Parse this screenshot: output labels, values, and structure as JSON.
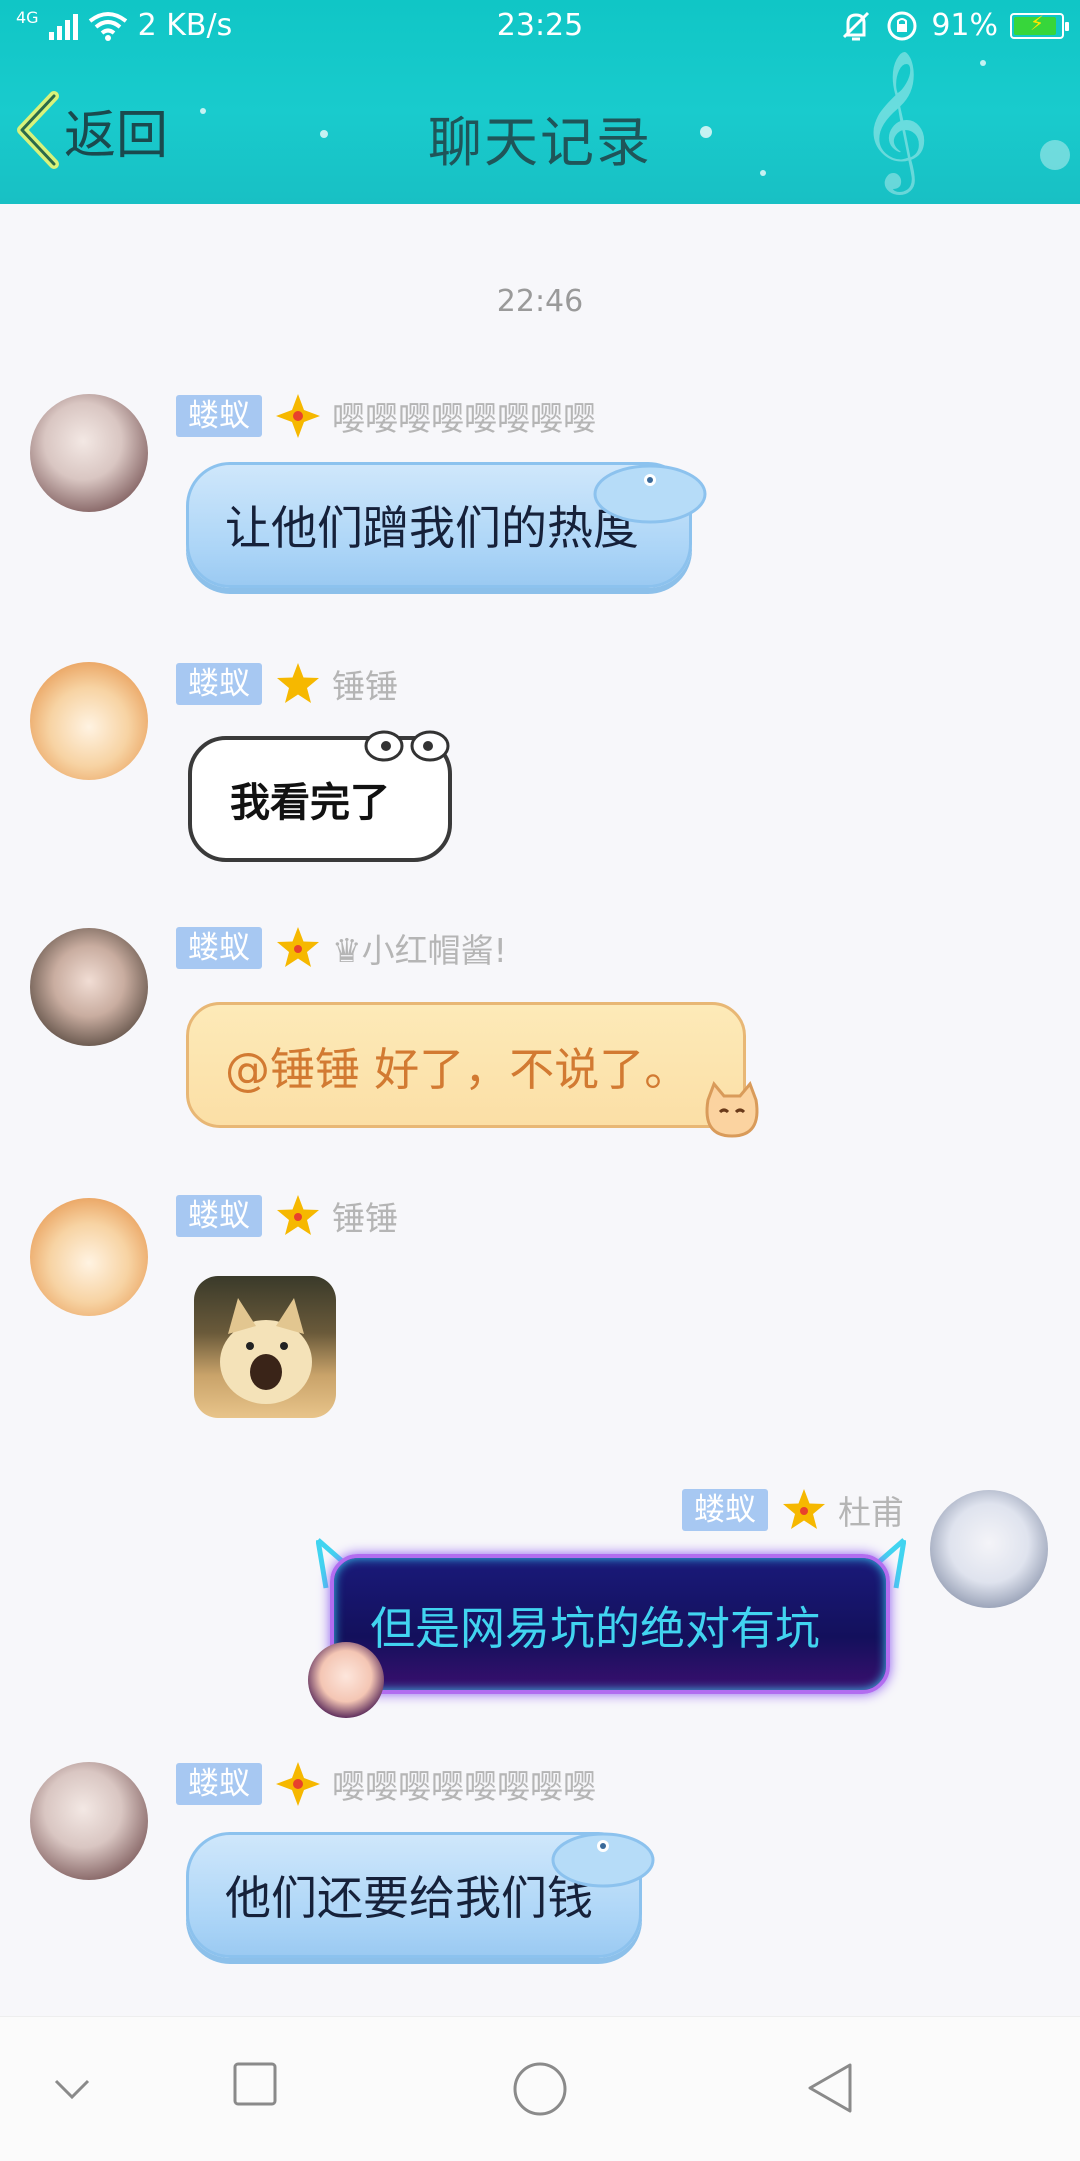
{
  "status_bar": {
    "network": "4G",
    "speed": "2 KB/s",
    "time": "23:25",
    "battery": "91%",
    "battery_level": 0.91
  },
  "header": {
    "back_label": "返回",
    "title": "聊天记录"
  },
  "timestamp": "22:46",
  "messages": [
    {
      "badge": "蝼蚁",
      "name": "嘤嘤嘤嘤嘤嘤嘤嘤",
      "text": "让他们蹭我们的热度",
      "side": "left",
      "avatar": "silver-hair-girl-avatar",
      "style": "blue-bubble"
    },
    {
      "badge": "蝼蚁",
      "name": "锤锤",
      "text": "我看完了",
      "side": "left",
      "avatar": "shiba-dog-avatar",
      "style": "white-bubble"
    },
    {
      "badge": "蝼蚁",
      "name": "♛小红帽酱!",
      "text": "@锤锤 好了，不说了。",
      "side": "left",
      "avatar": "girl-portrait-avatar",
      "style": "orange-bubble"
    },
    {
      "badge": "蝼蚁",
      "name": "锤锤",
      "text": "",
      "side": "left",
      "avatar": "shiba-dog-avatar",
      "style": "sticker",
      "sticker": "shiba-sticker"
    },
    {
      "badge": "蝼蚁",
      "name": "杜甫",
      "text": "但是网易坑的绝对有坑",
      "side": "right",
      "avatar": "ancient-scholar-avatar",
      "style": "dark-bubble"
    },
    {
      "badge": "蝼蚁",
      "name": "嘤嘤嘤嘤嘤嘤嘤嘤",
      "text": "他们还要给我们钱",
      "side": "left",
      "avatar": "silver-hair-girl-avatar",
      "style": "blue-bubble"
    }
  ],
  "colors": {
    "header": "#19cbcd",
    "badge": "#a7c8f2",
    "star": "#f6b800"
  }
}
